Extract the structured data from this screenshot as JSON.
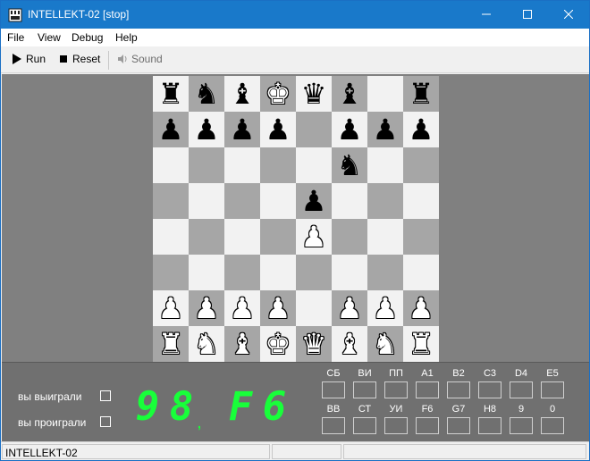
{
  "window": {
    "title": "INTELLEKT-02 [stop]"
  },
  "menu": {
    "file": "File",
    "view": "View",
    "debug": "Debug",
    "help": "Help"
  },
  "toolbar": {
    "run": "Run",
    "reset": "Reset",
    "sound": "Sound"
  },
  "board": {
    "rows": [
      [
        "bR",
        "bN",
        "bB",
        "wK",
        "bQ",
        "bB",
        "",
        "bR"
      ],
      [
        "bP",
        "bP",
        "bP",
        "bP",
        "",
        "bP",
        "bP",
        "bP"
      ],
      [
        "",
        "",
        "",
        "",
        "",
        "bN",
        "",
        ""
      ],
      [
        "",
        "",
        "",
        "",
        "bP",
        "",
        "",
        ""
      ],
      [
        "",
        "",
        "",
        "",
        "wP",
        "",
        "",
        ""
      ],
      [
        "",
        "",
        "",
        "",
        "",
        "",
        "",
        ""
      ],
      [
        "wP",
        "wP",
        "wP",
        "wP",
        "",
        "wP",
        "wP",
        "wP"
      ],
      [
        "wR",
        "wN",
        "wB",
        "wK",
        "wQ",
        "wB",
        "wN",
        "wR"
      ]
    ]
  },
  "panel": {
    "won_label": "вы выиграли",
    "lost_label": "вы проиграли",
    "display": [
      "9",
      "8",
      "F",
      "6"
    ],
    "keys_row1": [
      "СБ",
      "ВИ",
      "ПП",
      "A1",
      "B2",
      "C3",
      "D4",
      "E5"
    ],
    "keys_row2": [
      "ВВ",
      "СТ",
      "УИ",
      "F6",
      "G7",
      "H8",
      "9",
      "0"
    ]
  },
  "statusbar": {
    "text": "INTELLEKT-02"
  }
}
